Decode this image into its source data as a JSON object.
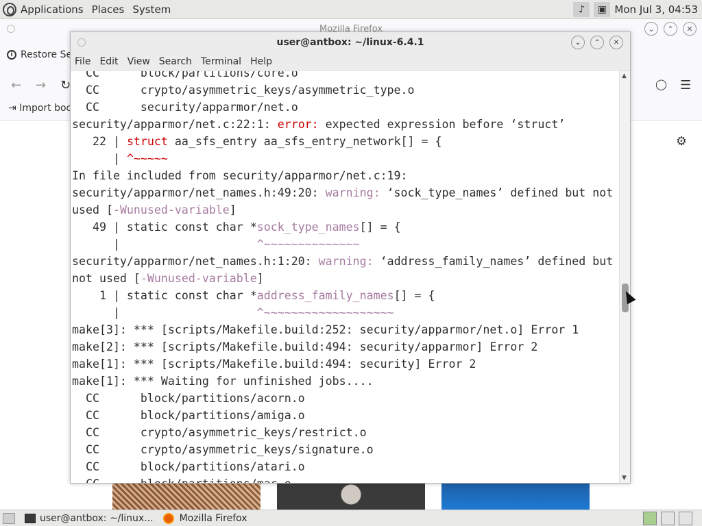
{
  "top_panel": {
    "menus": [
      "Applications",
      "Places",
      "System"
    ],
    "clock": "Mon Jul 3, 04:53"
  },
  "firefox": {
    "title": "Mozilla Firefox",
    "restore_label": "Restore Se",
    "import_label": "Import boo"
  },
  "terminal": {
    "title": "user@antbox: ~/linux-6.4.1",
    "menus": [
      "File",
      "Edit",
      "View",
      "Search",
      "Terminal",
      "Help"
    ],
    "lines": [
      {
        "segs": [
          {
            "t": "  CC      block/partitions/core.o"
          }
        ]
      },
      {
        "segs": [
          {
            "t": "  CC      crypto/asymmetric_keys/asymmetric_type.o"
          }
        ]
      },
      {
        "segs": [
          {
            "t": "  CC      security/apparmor/net.o"
          }
        ]
      },
      {
        "segs": [
          {
            "t": "security/apparmor/net.c:22:1: "
          },
          {
            "t": "error:",
            "c": "err"
          },
          {
            "t": " expected expression before ‘struct’"
          }
        ]
      },
      {
        "segs": [
          {
            "t": "   22 | "
          },
          {
            "t": "struct",
            "c": "err"
          },
          {
            "t": " aa_sfs_entry aa_sfs_entry_network[] = {"
          }
        ]
      },
      {
        "segs": [
          {
            "t": "      | "
          },
          {
            "t": "^~~~~~",
            "c": "err"
          }
        ]
      },
      {
        "segs": [
          {
            "t": "In file included from security/apparmor/net.c:19:"
          }
        ]
      },
      {
        "segs": [
          {
            "t": "security/apparmor/net_names.h:49:20: "
          },
          {
            "t": "warning:",
            "c": "warn"
          },
          {
            "t": " ‘sock_type_names’ defined but not"
          }
        ]
      },
      {
        "segs": [
          {
            "t": "used ["
          },
          {
            "t": "-Wunused-variable",
            "c": "warn"
          },
          {
            "t": "]"
          }
        ]
      },
      {
        "segs": [
          {
            "t": "   49 | static const char *"
          },
          {
            "t": "sock_type_names",
            "c": "warn"
          },
          {
            "t": "[] = {"
          }
        ]
      },
      {
        "segs": [
          {
            "t": "      |                    "
          },
          {
            "t": "^~~~~~~~~~~~~~~",
            "c": "warn"
          }
        ]
      },
      {
        "segs": [
          {
            "t": "security/apparmor/net_names.h:1:20: "
          },
          {
            "t": "warning:",
            "c": "warn"
          },
          {
            "t": " ‘address_family_names’ defined but"
          }
        ]
      },
      {
        "segs": [
          {
            "t": "not used ["
          },
          {
            "t": "-Wunused-variable",
            "c": "warn"
          },
          {
            "t": "]"
          }
        ]
      },
      {
        "segs": [
          {
            "t": "    1 | static const char *"
          },
          {
            "t": "address_family_names",
            "c": "warn"
          },
          {
            "t": "[] = {"
          }
        ]
      },
      {
        "segs": [
          {
            "t": "      |                    "
          },
          {
            "t": "^~~~~~~~~~~~~~~~~~~~",
            "c": "warn"
          }
        ]
      },
      {
        "segs": [
          {
            "t": "make[3]: *** [scripts/Makefile.build:252: security/apparmor/net.o] Error 1"
          }
        ]
      },
      {
        "segs": [
          {
            "t": "make[2]: *** [scripts/Makefile.build:494: security/apparmor] Error 2"
          }
        ]
      },
      {
        "segs": [
          {
            "t": "make[1]: *** [scripts/Makefile.build:494: security] Error 2"
          }
        ]
      },
      {
        "segs": [
          {
            "t": "make[1]: *** Waiting for unfinished jobs...."
          }
        ]
      },
      {
        "segs": [
          {
            "t": "  CC      block/partitions/acorn.o"
          }
        ]
      },
      {
        "segs": [
          {
            "t": "  CC      block/partitions/amiga.o"
          }
        ]
      },
      {
        "segs": [
          {
            "t": "  CC      crypto/asymmetric_keys/restrict.o"
          }
        ]
      },
      {
        "segs": [
          {
            "t": "  CC      crypto/asymmetric_keys/signature.o"
          }
        ]
      },
      {
        "segs": [
          {
            "t": "  CC      block/partitions/atari.o"
          }
        ]
      },
      {
        "segs": [
          {
            "t": "  CC      block/partitions/mac.o"
          }
        ]
      }
    ]
  },
  "taskbar": {
    "items": [
      {
        "label": "user@antbox: ~/linux..."
      },
      {
        "label": "Mozilla Firefox"
      }
    ]
  },
  "colors": {
    "error": "#cc0000",
    "warning": "#a67ba0",
    "text": "#2e2e2e"
  }
}
